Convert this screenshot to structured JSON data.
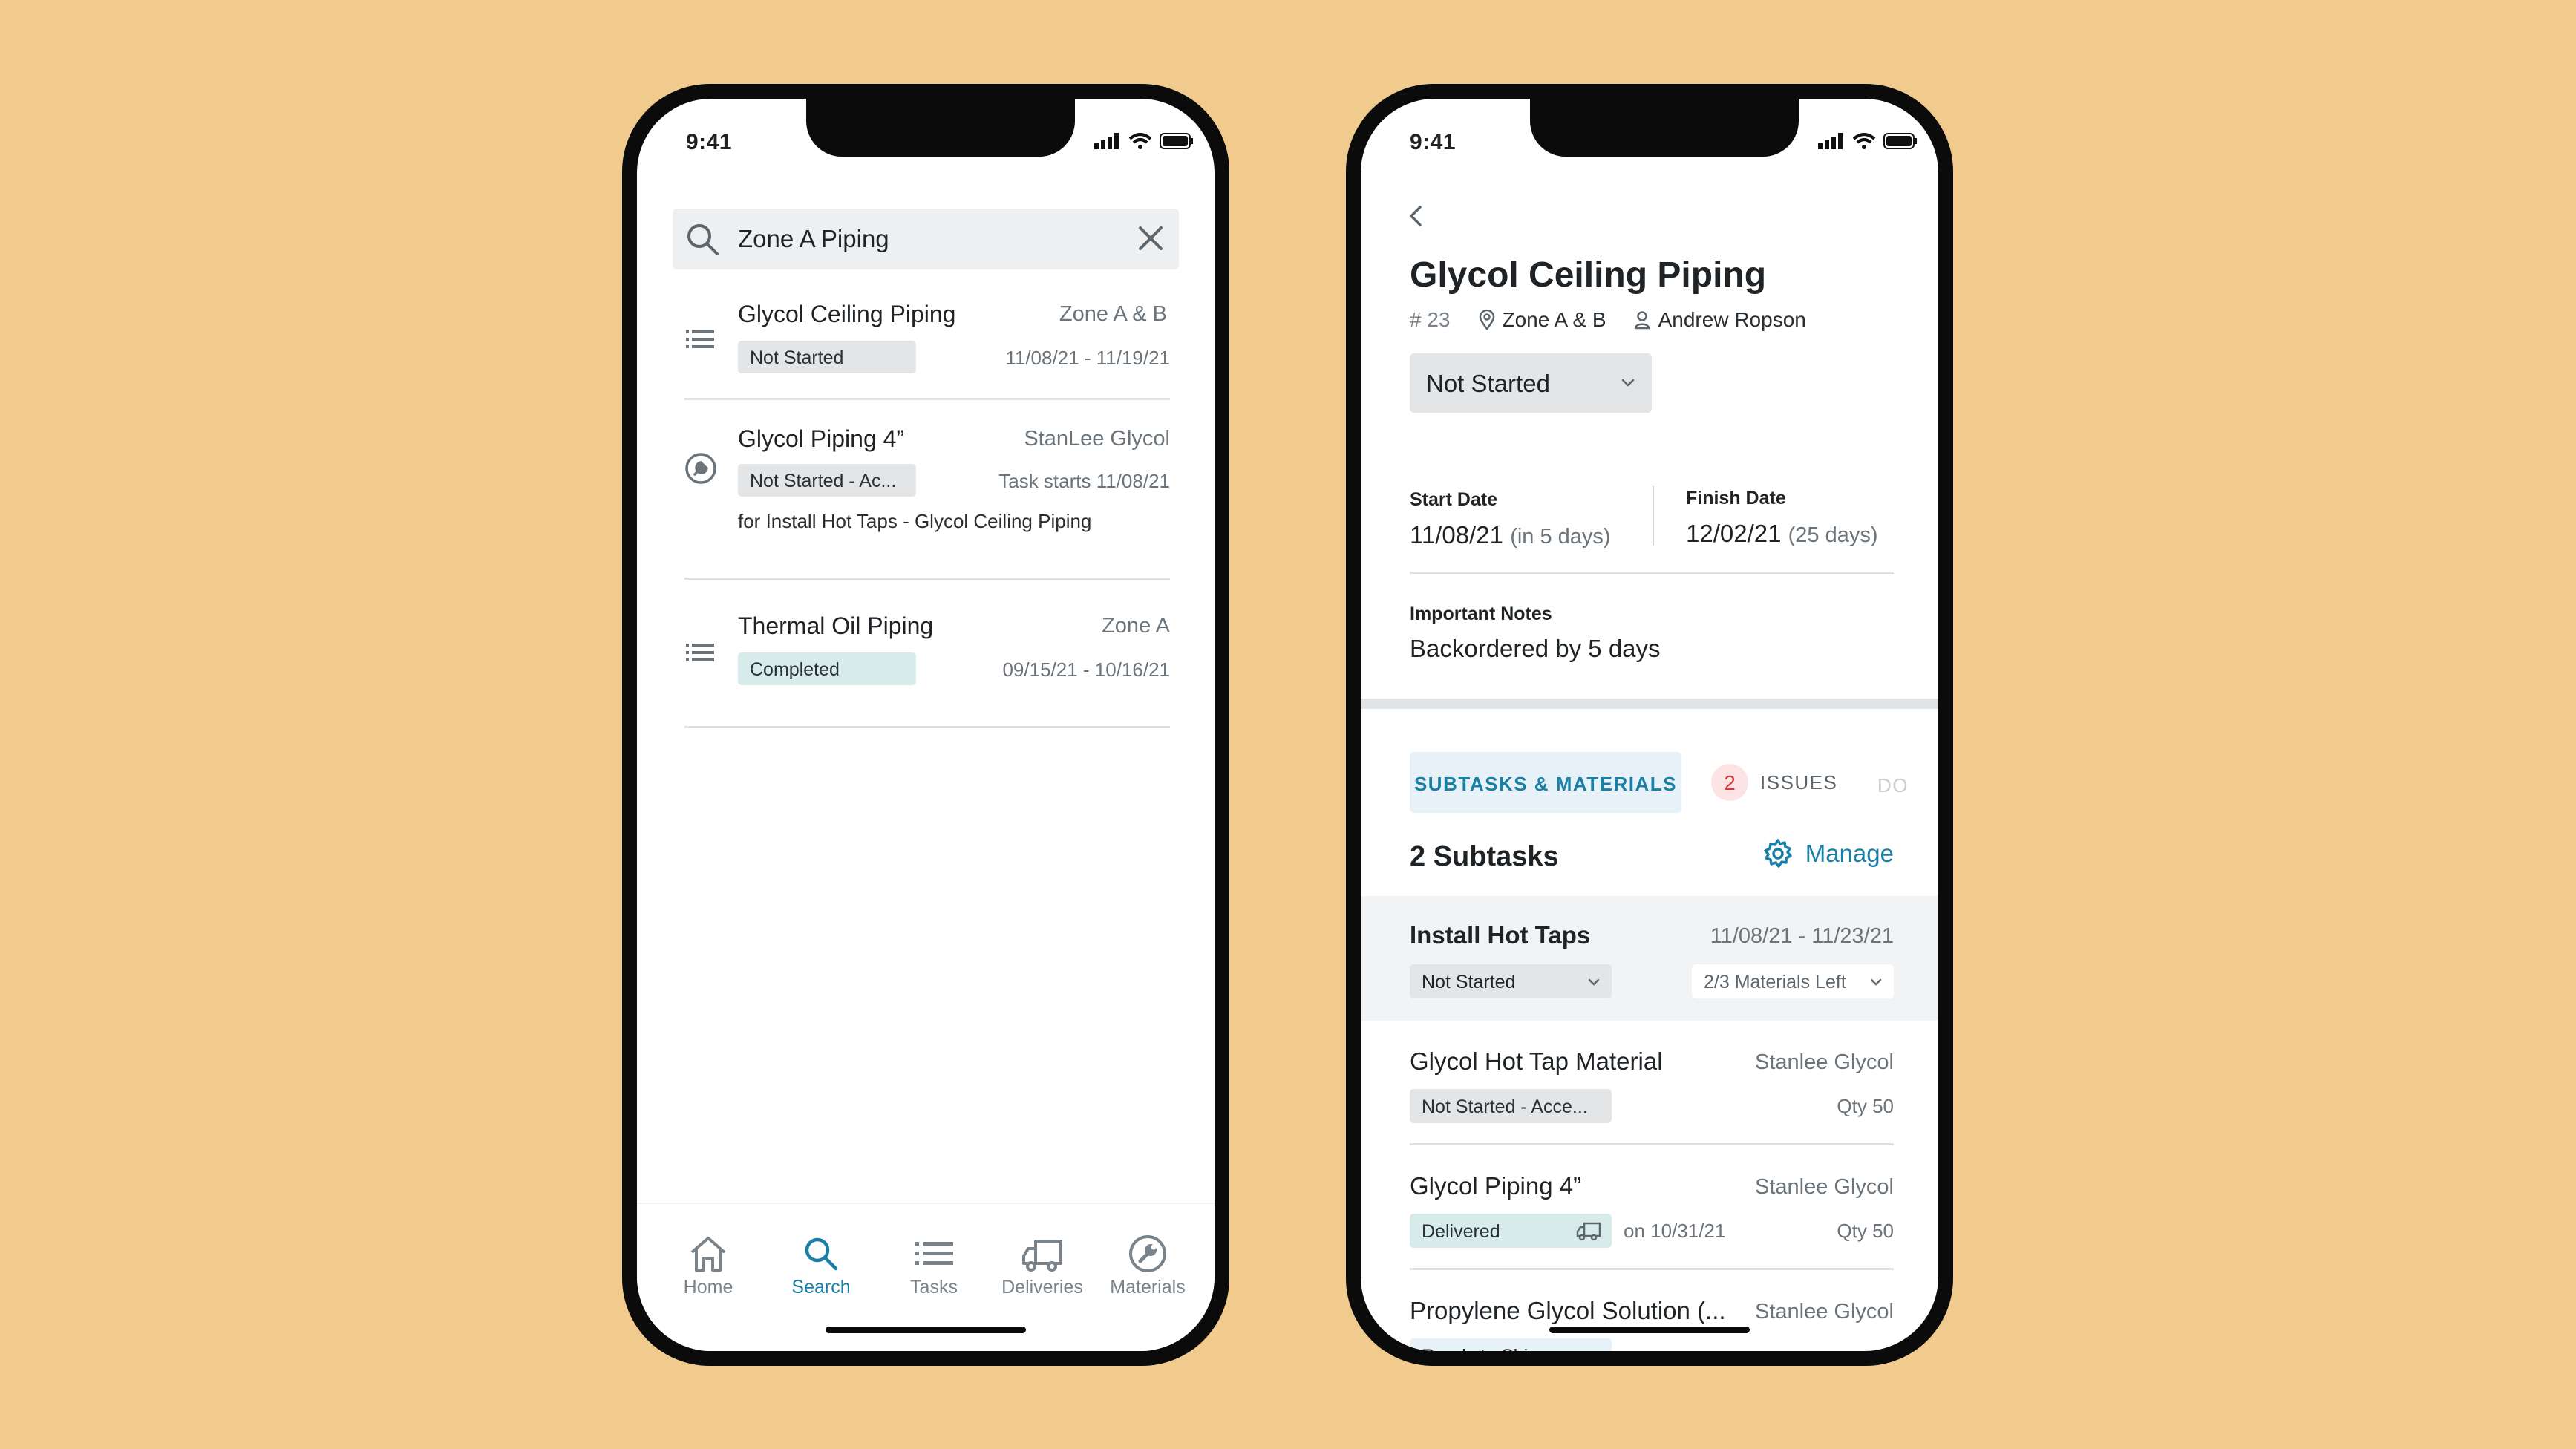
{
  "colors": {
    "background": "#f1cb8e",
    "accent": "#1a7fa6",
    "badge_gray": "#e3e5e7",
    "badge_teal": "#d7ecea",
    "danger": "#d23c3c"
  },
  "left_phone": {
    "status_time": "9:41",
    "search": {
      "value": "Zone A Piping"
    },
    "results": [
      {
        "icon": "list-icon",
        "title": "Glycol Ceiling Piping",
        "right": "Zone A & B",
        "badge": "Not Started",
        "date": "11/08/21 - 11/19/21"
      },
      {
        "icon": "wrench-circle-icon",
        "title": "Glycol Piping 4”",
        "right": "StanLee Glycol",
        "badge": "Not Started - Ac...",
        "date": "Task starts 11/08/21",
        "sub": "for Install Hot Taps - Glycol Ceiling Piping"
      },
      {
        "icon": "list-icon",
        "title": "Thermal Oil Piping",
        "right": "Zone A",
        "badge": "Completed",
        "date": "09/15/21 - 10/16/21"
      }
    ],
    "nav": [
      {
        "label": "Home",
        "icon": "home-icon"
      },
      {
        "label": "Search",
        "icon": "search-icon",
        "active": true
      },
      {
        "label": "Tasks",
        "icon": "list-icon"
      },
      {
        "label": "Deliveries",
        "icon": "truck-icon"
      },
      {
        "label": "Materials",
        "icon": "wrench-circle-icon"
      }
    ]
  },
  "right_phone": {
    "status_time": "9:41",
    "title": "Glycol Ceiling Piping",
    "number": "# 23",
    "zone": "Zone A & B",
    "assignee": "Andrew Ropson",
    "status": "Not Started",
    "start_date": {
      "label": "Start Date",
      "value": "11/08/21",
      "relative": "(in 5 days)"
    },
    "finish_date": {
      "label": "Finish Date",
      "value": "12/02/21",
      "relative": "(25 days)"
    },
    "notes": {
      "label": "Important Notes",
      "value": "Backordered by 5 days"
    },
    "tabs": {
      "active": "SUBTASKS & MATERIALS",
      "issues_count": "2",
      "issues": "ISSUES",
      "docs": "DO"
    },
    "subtasks_heading": "2 Subtasks",
    "manage": "Manage",
    "subtask": {
      "title": "Install Hot Taps",
      "dates": "11/08/21 - 11/23/21",
      "status": "Not Started",
      "materials": "2/3 Materials Left"
    },
    "materials": [
      {
        "title": "Glycol Hot Tap Material",
        "vendor": "Stanlee Glycol",
        "badge": "Not Started - Acce...",
        "qty": "Qty 50"
      },
      {
        "title": "Glycol Piping 4”",
        "vendor": "Stanlee Glycol",
        "badge": "Delivered",
        "on": "on 10/31/21",
        "qty": "Qty 50"
      },
      {
        "title": "Propylene Glycol Solution (...",
        "vendor": "Stanlee Glycol",
        "badge": "Ready to Ship"
      }
    ]
  }
}
